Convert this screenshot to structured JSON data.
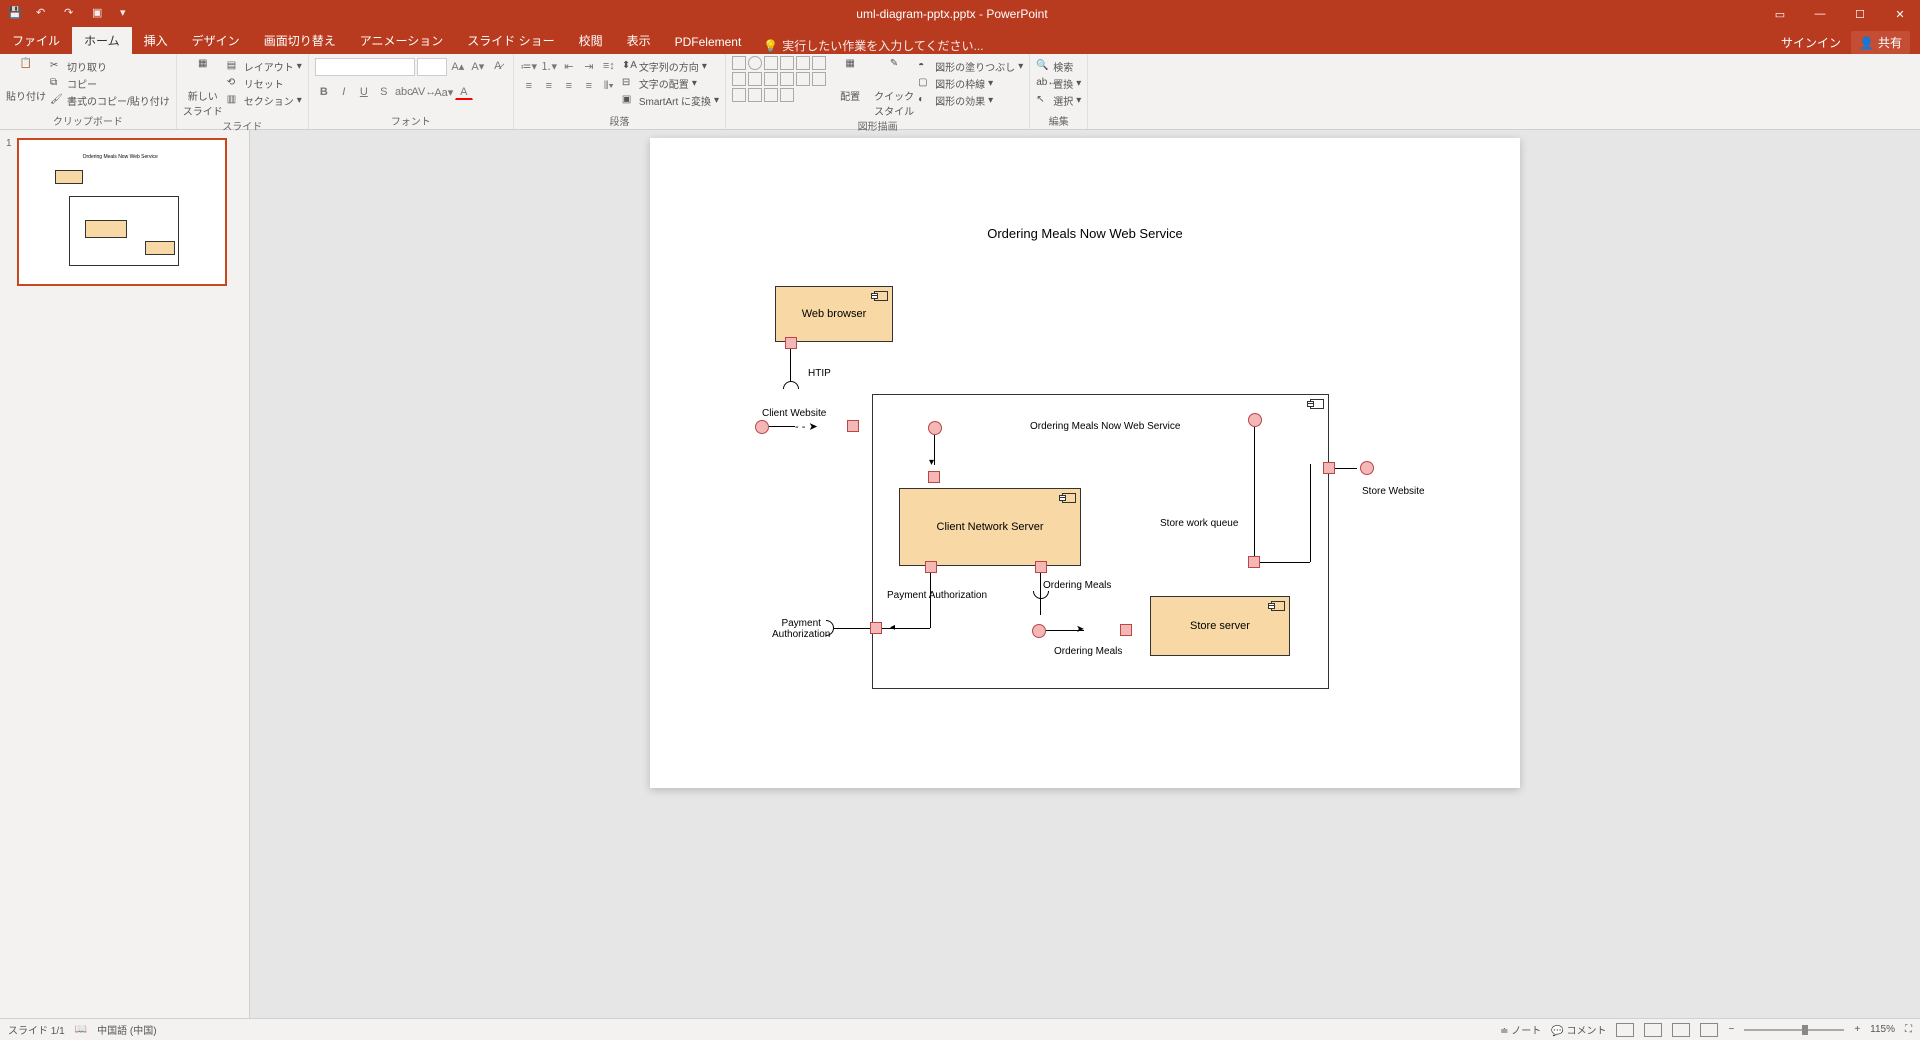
{
  "title": "uml-diagram-pptx.pptx - PowerPoint",
  "quick_access": {
    "save": "保存",
    "undo": "元に戻す",
    "redo": "やり直し",
    "start": "最初から開始"
  },
  "tabs": {
    "file": "ファイル",
    "home": "ホーム",
    "insert": "挿入",
    "design": "デザイン",
    "transitions": "画面切り替え",
    "animations": "アニメーション",
    "slideshow": "スライド ショー",
    "review": "校閲",
    "view": "表示",
    "pdfelement": "PDFelement",
    "tell_me": "実行したい作業を入力してください...",
    "sign_in": "サインイン",
    "share": "共有"
  },
  "ribbon": {
    "clipboard": {
      "label": "クリップボード",
      "paste": "貼り付け",
      "cut": "切り取り",
      "copy": "コピー",
      "format_painter": "書式のコピー/貼り付け"
    },
    "slides": {
      "label": "スライド",
      "new_slide": "新しい\nスライド",
      "layout": "レイアウト",
      "reset": "リセット",
      "section": "セクション"
    },
    "font": {
      "label": "フォント"
    },
    "paragraph": {
      "label": "段落",
      "text_direction": "文字列の方向",
      "align_text": "文字の配置",
      "smartart": "SmartArt に変換"
    },
    "drawing": {
      "label": "図形描画",
      "arrange": "配置",
      "quick_styles": "クイック\nスタイル",
      "shape_fill": "図形の塗りつぶし",
      "shape_outline": "図形の枠線",
      "shape_effects": "図形の効果"
    },
    "editing": {
      "label": "編集",
      "find": "検索",
      "replace": "置換",
      "select": "選択"
    }
  },
  "diagram": {
    "title": "Ordering Meals Now Web Service",
    "web_browser": "Web browser",
    "http": "HTIP",
    "client_website": "Client Website",
    "service_container": "Ordering Meals Now Web Service",
    "client_network_server": "Client Network Server",
    "payment_auth": "Payment Authorization",
    "payment_auth2": "Payment\nAuthorization",
    "ordering_meals": "Ordering Meals",
    "ordering_meals2": "Ordering Meals",
    "store_work_queue": "Store work queue",
    "store_server": "Store server",
    "store_website": "Store Website"
  },
  "status": {
    "slide_count": "スライド 1/1",
    "language": "中国語 (中国)",
    "notes": "ノート",
    "comments": "コメント",
    "zoom": "115%"
  },
  "thumb_number": "1"
}
